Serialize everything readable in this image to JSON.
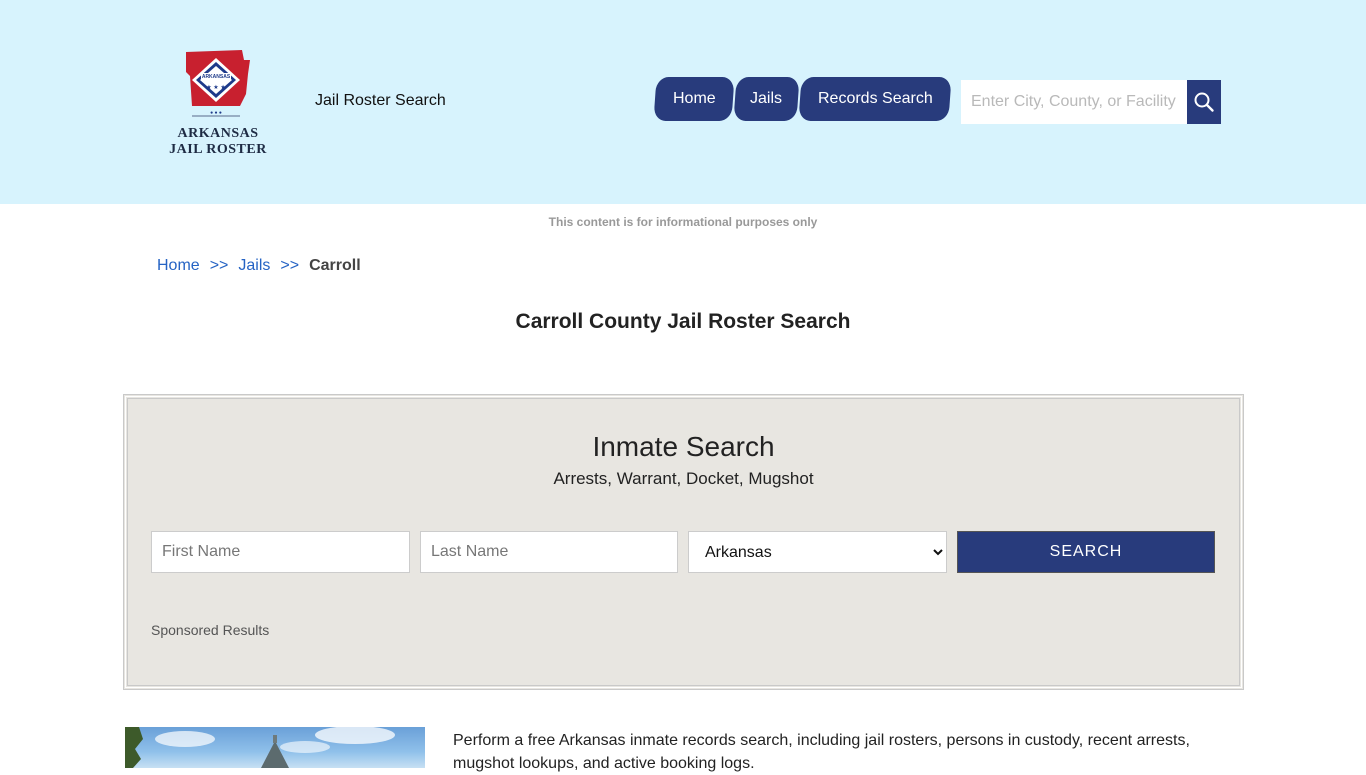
{
  "header": {
    "logo_line1": "ARKANSAS",
    "logo_line2": "JAIL ROSTER",
    "logo_badge": "ARKANSAS",
    "tagline": "Jail Roster Search",
    "nav": [
      {
        "label": "Home"
      },
      {
        "label": "Jails"
      },
      {
        "label": "Records Search"
      }
    ],
    "search_placeholder": "Enter City, County, or Facility",
    "colors": {
      "background": "#d7f3fd",
      "accent": "#283b7c"
    }
  },
  "disclaimer": "This content is for informational purposes only",
  "breadcrumb": {
    "items": [
      {
        "label": "Home"
      },
      {
        "label": "Jails"
      }
    ],
    "separator": ">>",
    "current": "Carroll"
  },
  "page_title": "Carroll County Jail Roster Search",
  "inmate_search": {
    "title": "Inmate Search",
    "subtitle": "Arrests, Warrant, Docket, Mugshot",
    "first_name_placeholder": "First Name",
    "last_name_placeholder": "Last Name",
    "state_selected": "Arkansas",
    "submit_label": "SEARCH",
    "sponsored_label": "Sponsored Results"
  },
  "intro_text": "Perform a free Arkansas inmate records search, including jail rosters, persons in custody, recent arrests, mugshot lookups, and active booking logs."
}
